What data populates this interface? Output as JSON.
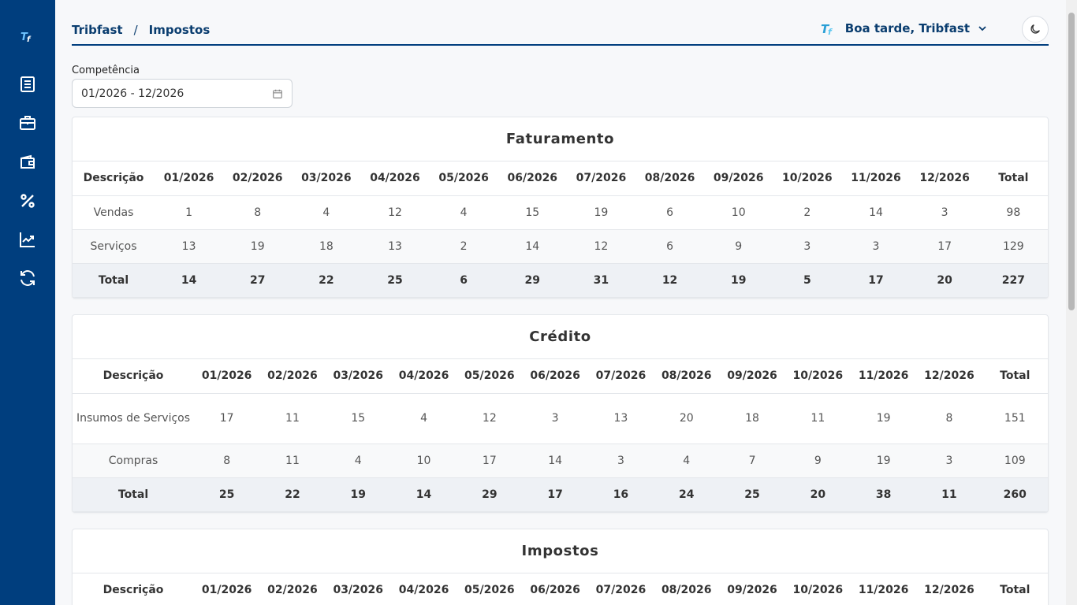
{
  "sidebar": {
    "logo": "TF",
    "items": [
      {
        "icon": "document-icon"
      },
      {
        "icon": "briefcase-icon"
      },
      {
        "icon": "wallet-icon"
      },
      {
        "icon": "percent-icon"
      },
      {
        "icon": "chart-line-icon"
      },
      {
        "icon": "refresh-icon"
      }
    ]
  },
  "header": {
    "breadcrumb": [
      "Tribfast",
      "Impostos"
    ],
    "breadcrumb_separator": "/",
    "greeting": "Boa tarde, Tribfast",
    "theme_icon": "moon-icon"
  },
  "filter": {
    "label": "Competência",
    "value": "01/2026 - 12/2026"
  },
  "months": [
    "01/2026",
    "02/2026",
    "03/2026",
    "04/2026",
    "05/2026",
    "06/2026",
    "07/2026",
    "08/2026",
    "09/2026",
    "10/2026",
    "11/2026",
    "12/2026"
  ],
  "desc_header": "Descrição",
  "total_header": "Total",
  "faturamento": {
    "title": "Faturamento",
    "rows": [
      {
        "label": "Vendas",
        "values": [
          "1",
          "8",
          "4",
          "12",
          "4",
          "15",
          "19",
          "6",
          "10",
          "2",
          "14",
          "3"
        ],
        "total": "98"
      },
      {
        "label": "Serviços",
        "values": [
          "13",
          "19",
          "18",
          "13",
          "2",
          "14",
          "12",
          "6",
          "9",
          "3",
          "3",
          "17"
        ],
        "total": "129"
      },
      {
        "label": "Total",
        "values": [
          "14",
          "27",
          "22",
          "25",
          "6",
          "29",
          "31",
          "12",
          "19",
          "5",
          "17",
          "20"
        ],
        "total": "227"
      }
    ]
  },
  "credito": {
    "title": "Crédito",
    "rows": [
      {
        "label": "Insumos de Serviços",
        "values": [
          "17",
          "11",
          "15",
          "4",
          "12",
          "3",
          "13",
          "20",
          "18",
          "11",
          "19",
          "8"
        ],
        "total": "151"
      },
      {
        "label": "Compras",
        "values": [
          "8",
          "11",
          "4",
          "10",
          "17",
          "14",
          "3",
          "4",
          "7",
          "9",
          "19",
          "3"
        ],
        "total": "109"
      },
      {
        "label": "Total",
        "values": [
          "25",
          "22",
          "19",
          "14",
          "29",
          "17",
          "16",
          "24",
          "25",
          "20",
          "38",
          "11"
        ],
        "total": "260"
      }
    ]
  },
  "impostos": {
    "title": "Impostos"
  }
}
